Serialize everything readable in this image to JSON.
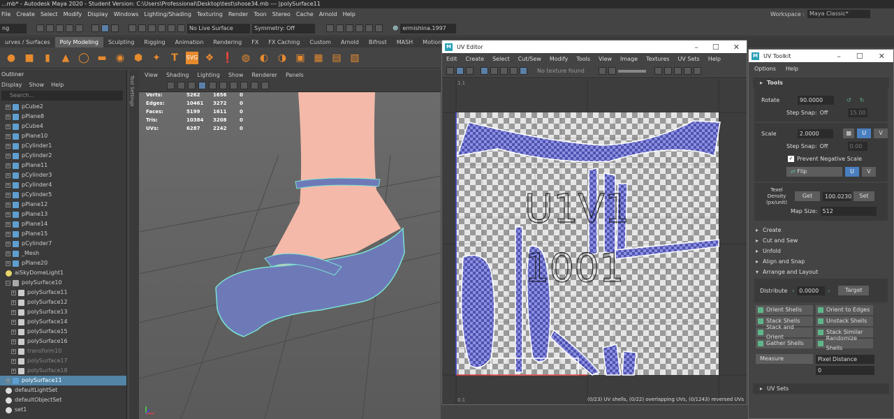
{
  "title": "...mb* - Autodesk Maya 2020 - Student Version: C:\\Users\\Professional\\Desktop\\test\\shose34.mb   ---   |polySurface11",
  "menu": [
    "File",
    "Create",
    "Select",
    "Modify",
    "Display",
    "Windows",
    "Lighting/Shading",
    "Texturing",
    "Render",
    "Toon",
    "Stereo",
    "Cache",
    "Arnold",
    "Help"
  ],
  "workspace": {
    "label": "Workspace :",
    "value": "Maya Classic*"
  },
  "statusline": {
    "mode": "ng",
    "live_surface": "No Live Surface",
    "symmetry": "Symmetry: Off",
    "user": "ermishina.1997"
  },
  "shelf_tabs": [
    "urves / Surfaces",
    "Poly Modeling",
    "Sculpting",
    "Rigging",
    "Animation",
    "Rendering",
    "FX",
    "FX Caching",
    "Custom",
    "Arnold",
    "Bifrost",
    "MASH",
    "Motion Gra"
  ],
  "outliner": {
    "title": "Outliner",
    "menu": [
      "Display",
      "Show",
      "Help"
    ],
    "search_placeholder": "Search...",
    "items": [
      {
        "label": "pCube2",
        "type": "mesh",
        "state": ""
      },
      {
        "label": "pPlane8",
        "type": "mesh",
        "state": ""
      },
      {
        "label": "pCube4",
        "type": "mesh",
        "state": ""
      },
      {
        "label": "pPlane10",
        "type": "mesh",
        "state": ""
      },
      {
        "label": "pCylinder1",
        "type": "mesh",
        "state": ""
      },
      {
        "label": "pCylinder2",
        "type": "mesh",
        "state": ""
      },
      {
        "label": "pPlane11",
        "type": "mesh",
        "state": ""
      },
      {
        "label": "pCylinder3",
        "type": "mesh",
        "state": ""
      },
      {
        "label": "pCylinder4",
        "type": "mesh",
        "state": ""
      },
      {
        "label": "pCylinder5",
        "type": "mesh",
        "state": ""
      },
      {
        "label": "pPlane12",
        "type": "mesh",
        "state": ""
      },
      {
        "label": "pPlane13",
        "type": "mesh",
        "state": ""
      },
      {
        "label": "pPlane14",
        "type": "mesh",
        "state": ""
      },
      {
        "label": "pPlane15",
        "type": "mesh",
        "state": ""
      },
      {
        "label": "pCylinder7",
        "type": "mesh",
        "state": ""
      },
      {
        "label": "_Mesh",
        "type": "mesh",
        "state": ""
      },
      {
        "label": "pPlane20",
        "type": "mesh",
        "state": ""
      },
      {
        "label": "aiSkyDomeLight1",
        "type": "light",
        "state": ""
      },
      {
        "label": "polySurface10",
        "type": "group",
        "state": ""
      },
      {
        "label": "polySurface11",
        "type": "sub",
        "state": ""
      },
      {
        "label": "polySurface12",
        "type": "sub",
        "state": ""
      },
      {
        "label": "polySurface13",
        "type": "sub",
        "state": ""
      },
      {
        "label": "polySurface14",
        "type": "sub",
        "state": ""
      },
      {
        "label": "polySurface15",
        "type": "sub",
        "state": ""
      },
      {
        "label": "polySurface16",
        "type": "sub",
        "state": ""
      },
      {
        "label": "transform10",
        "type": "sub",
        "state": "dim"
      },
      {
        "label": "polySurface17",
        "type": "sub",
        "state": "dim"
      },
      {
        "label": "polySurface18",
        "type": "sub",
        "state": "dim"
      },
      {
        "label": "polySurface11",
        "type": "mesh",
        "state": "sel"
      },
      {
        "label": "defaultLightSet",
        "type": "set",
        "state": ""
      },
      {
        "label": "defaultObjectSet",
        "type": "set",
        "state": ""
      },
      {
        "label": "set1",
        "type": "set",
        "state": ""
      }
    ]
  },
  "tool_settings_label": "Tool Settings",
  "viewport": {
    "menu": [
      "View",
      "Shading",
      "Lighting",
      "Show",
      "Renderer",
      "Panels"
    ],
    "hud": [
      {
        "label": "Verts:",
        "a": "5262",
        "b": "1656",
        "c": "0"
      },
      {
        "label": "Edges:",
        "a": "10461",
        "b": "3272",
        "c": "0"
      },
      {
        "label": "Faces:",
        "a": "5199",
        "b": "1611",
        "c": "0"
      },
      {
        "label": "Tris:",
        "a": "10384",
        "b": "3208",
        "c": "0"
      },
      {
        "label": "UVs:",
        "a": "6287",
        "b": "2242",
        "c": "0"
      }
    ]
  },
  "uv_editor": {
    "title": "UV Editor",
    "menu": [
      "Edit",
      "Create",
      "Select",
      "Cut/Sew",
      "Modify",
      "Tools",
      "View",
      "Image",
      "Textures",
      "UV Sets",
      "Help"
    ],
    "texture": "No texture found",
    "tile_label_1": "U1V1",
    "tile_label_2": "1001",
    "corner_top": "1.1",
    "corner_bottom": "0.1",
    "status": "(0/23) UV shells, (0/22) overlapping UVs, (0/1243) reversed UVs"
  },
  "uv_toolkit": {
    "title": "UV Toolkit",
    "menu": [
      "Options",
      "Help"
    ],
    "tools_label": "Tools",
    "rotate_label": "Rotate",
    "rotate_value": "90.0000",
    "step_snap_label": "Step Snap:",
    "step_snap_value": "Off",
    "rotate_step_value": "15.00",
    "scale_label": "Scale",
    "scale_value": "2.0000",
    "scale_step_value": "0.00",
    "u": "U",
    "v": "V",
    "prevent_negative": "Prevent Negative Scale",
    "flip_label": "Flip",
    "texel_label": "Texel Density (px/unit)",
    "get_label": "Get",
    "texel_value": "100.0230",
    "set_label": "Set",
    "map_size_label": "Map Size:",
    "map_size_value": "512",
    "sections": [
      "Create",
      "Cut and Sew",
      "Unfold",
      "Align and Snap",
      "Arrange and Layout"
    ],
    "distribute_label": "Distribute",
    "distribute_value": "0.0000",
    "target_label": "Target",
    "ops": [
      "Orient Shells",
      "Orient to Edges",
      "Stack Shells",
      "Unstack Shells",
      "Stack and Orient",
      "Stack Similar",
      "Gather Shells",
      "Randomize Shells"
    ],
    "measure_label": "Measure",
    "measure_mode": "Pixel Distance",
    "measure_value": "0",
    "uv_sets_label": "UV Sets"
  },
  "colors": {
    "accent": "#5285a6",
    "maya_teal": "#2aa0b8",
    "uv_shell": "#6d72d8"
  }
}
